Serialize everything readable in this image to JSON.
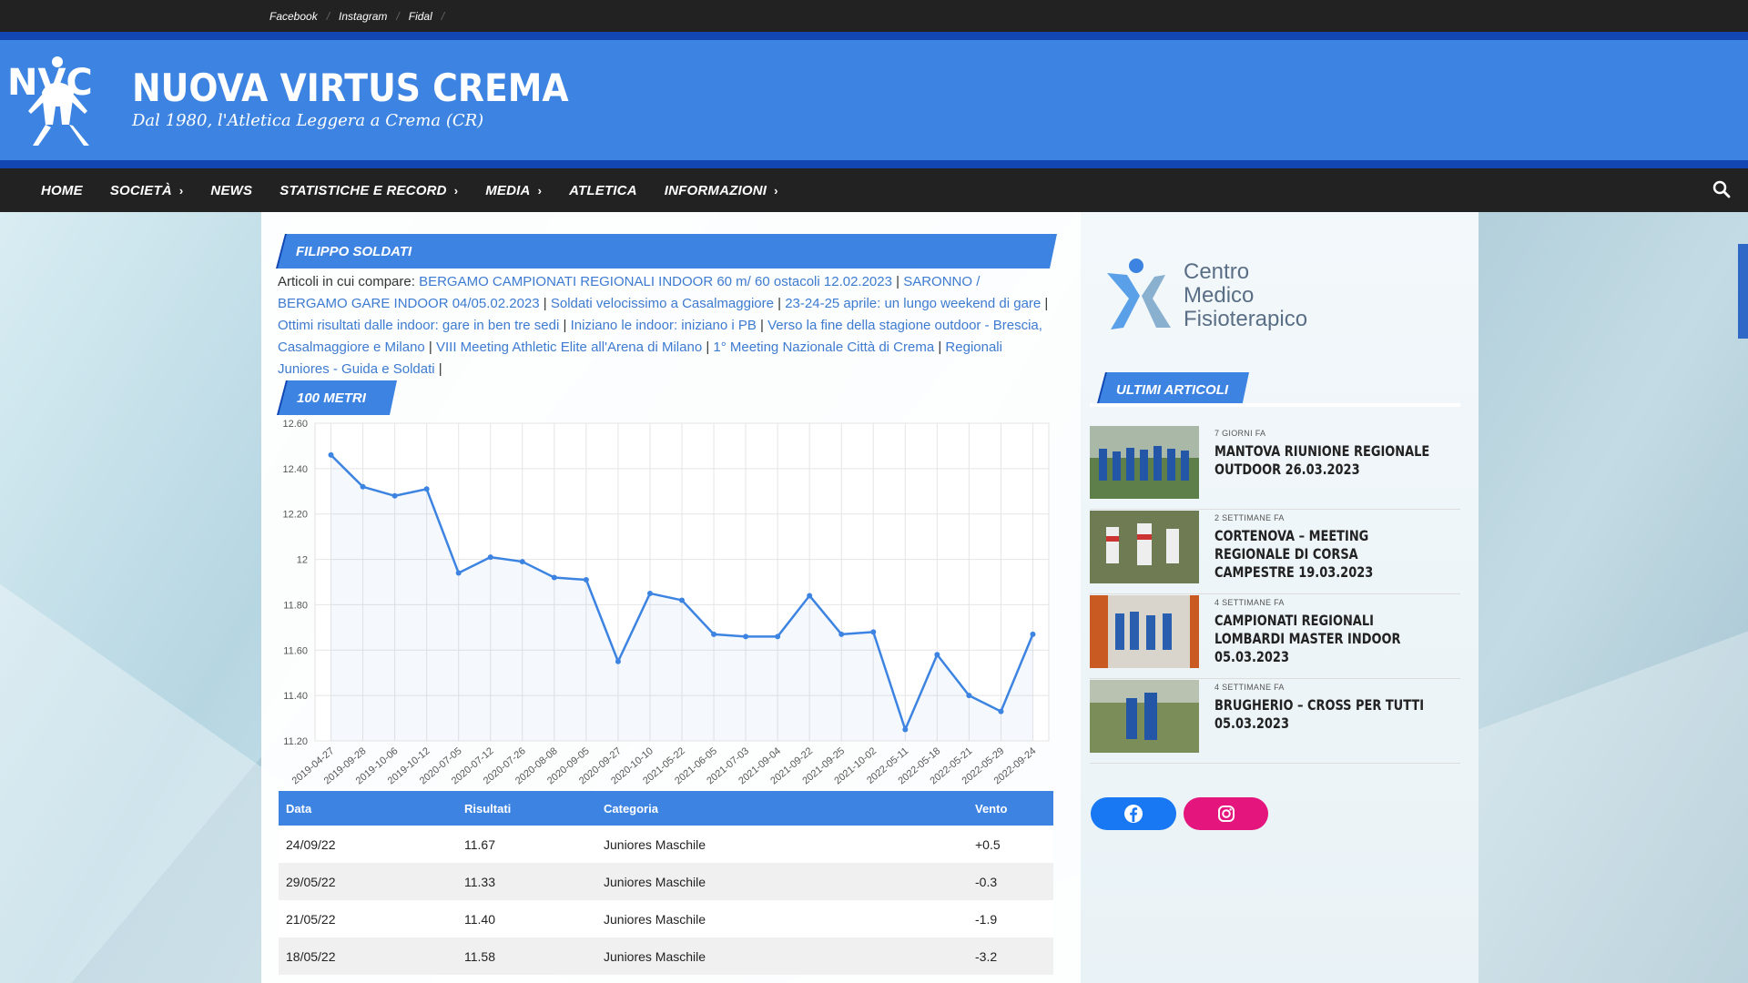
{
  "topbar": {
    "links": [
      "Facebook",
      "Instagram",
      "Fidal"
    ]
  },
  "site": {
    "title": "NUOVA VIRTUS CREMA",
    "tagline": "Dal 1980, l'Atletica Leggera a Crema (CR)",
    "logo_text": "NVC"
  },
  "nav": {
    "items": [
      {
        "label": "HOME",
        "chevron": false
      },
      {
        "label": "SOCIETÀ",
        "chevron": true
      },
      {
        "label": "NEWS",
        "chevron": false
      },
      {
        "label": "STATISTICHE E RECORD",
        "chevron": true
      },
      {
        "label": "MEDIA",
        "chevron": true
      },
      {
        "label": "ATLETICA",
        "chevron": false
      },
      {
        "label": "INFORMAZIONI",
        "chevron": true
      }
    ],
    "search_icon": "search-icon"
  },
  "athlete": {
    "name": "FILIPPO SOLDATI",
    "articles_label": "Articoli in cui compare:",
    "articles": [
      "BERGAMO CAMPIONATI REGIONALI INDOOR 60 m/ 60 ostacoli 12.02.2023",
      "SARONNO / BERGAMO GARE INDOOR 04/05.02.2023",
      "Soldati velocissimo a Casalmaggiore",
      "23-24-25 aprile: un lungo weekend di gare",
      "Ottimi risultati dalle indoor: gare in ben tre sedi",
      "Iniziano le indoor: iniziano i PB",
      "Verso la fine della stagione outdoor - Brescia, Casalmaggiore e Milano",
      "VIII Meeting Athletic Elite all'Arena di Milano",
      "1° Meeting Nazionale Città di Crema",
      "Regionali Juniores - Guida e Soldati"
    ]
  },
  "event": {
    "title": "100 METRI"
  },
  "chart_data": {
    "type": "line",
    "x": [
      "2019-04-27",
      "2019-09-28",
      "2019-10-06",
      "2019-10-12",
      "2020-07-05",
      "2020-07-12",
      "2020-07-26",
      "2020-08-08",
      "2020-09-05",
      "2020-09-27",
      "2020-10-10",
      "2021-05-22",
      "2021-06-05",
      "2021-07-03",
      "2021-09-04",
      "2021-09-22",
      "2021-09-25",
      "2021-10-02",
      "2022-05-11",
      "2022-05-18",
      "2022-05-21",
      "2022-05-29",
      "2022-09-24"
    ],
    "series": [
      {
        "values": [
          12.46,
          12.32,
          12.28,
          12.31,
          11.94,
          12.01,
          11.99,
          11.92,
          11.91,
          11.55,
          11.85,
          11.82,
          11.67,
          11.66,
          11.66,
          11.84,
          11.67,
          11.68,
          11.25,
          11.58,
          11.4,
          11.33,
          11.67
        ]
      }
    ],
    "ylim": [
      11.2,
      12.6
    ],
    "yticks": [
      "11.20",
      "11.40",
      "11.60",
      "11.80",
      "12",
      "12.20",
      "12.40",
      "12.60"
    ],
    "grid": true,
    "color": "#3d84e2"
  },
  "table": {
    "headers": [
      "Data",
      "Risultati",
      "Categoria",
      "Vento"
    ],
    "rows": [
      [
        "24/09/22",
        "11.67",
        "Juniores Maschile",
        "+0.5"
      ],
      [
        "29/05/22",
        "11.33",
        "Juniores Maschile",
        "-0.3"
      ],
      [
        "21/05/22",
        "11.40",
        "Juniores Maschile",
        "-1.9"
      ],
      [
        "18/05/22",
        "11.58",
        "Juniores Maschile",
        "-3.2"
      ]
    ]
  },
  "sidebar": {
    "sponsor": {
      "line1": "Centro",
      "line2": "Medico",
      "line3": "Fisioterapico"
    },
    "latest_title": "ULTIMI ARTICOLI",
    "posts": [
      {
        "ago": "7 GIORNI FA",
        "title": "MANTOVA RIUNIONE REGIONALE OUTDOOR 26.03.2023"
      },
      {
        "ago": "2 SETTIMANE FA",
        "title": "CORTENOVA – MEETING REGIONALE DI CORSA CAMPESTRE 19.03.2023"
      },
      {
        "ago": "4 SETTIMANE FA",
        "title": "CAMPIONATI REGIONALI LOMBARDI MASTER INDOOR 05.03.2023"
      },
      {
        "ago": "4 SETTIMANE FA",
        "title": "BRUGHERIO – CROSS PER TUTTI 05.03.2023"
      }
    ],
    "social": [
      {
        "icon": "facebook-icon",
        "color": "#1877f2"
      },
      {
        "icon": "instagram-icon",
        "color": "#e4157d"
      }
    ]
  }
}
